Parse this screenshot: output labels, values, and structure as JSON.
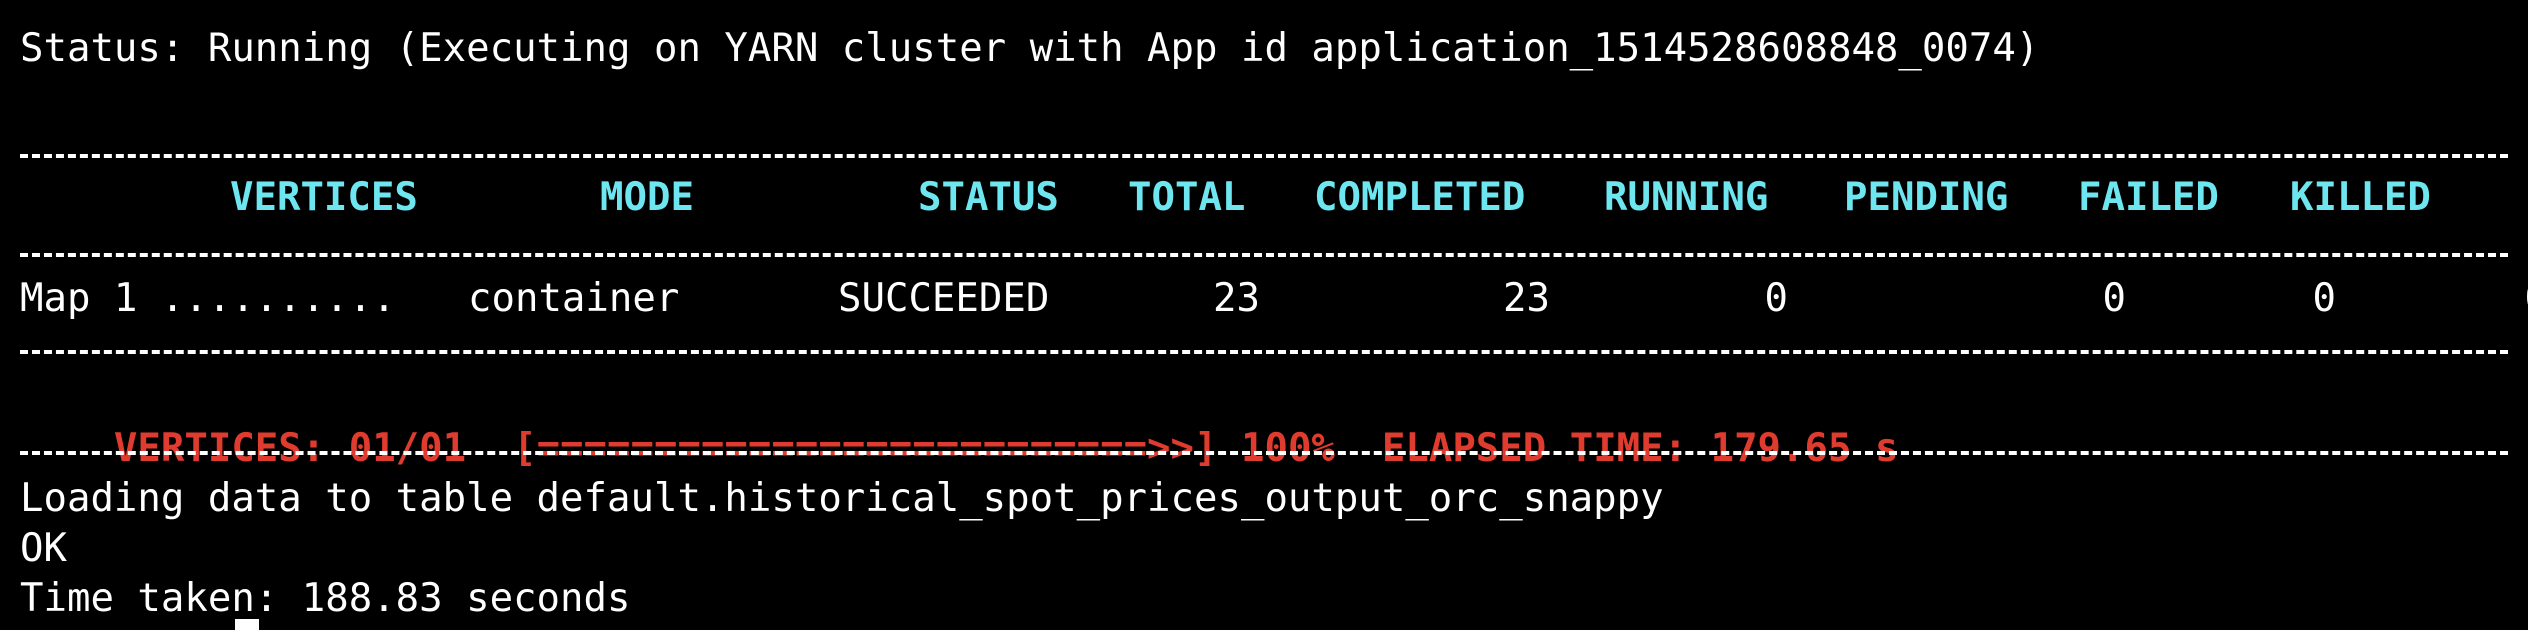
{
  "terminal": {
    "status_line": "Status: Running (Executing on YARN cluster with App id application_1514528608848_0074)",
    "columns": [
      "VERTICES",
      "MODE",
      "STATUS",
      "TOTAL",
      "COMPLETED",
      "RUNNING",
      "PENDING",
      "FAILED",
      "KILLED"
    ],
    "rows": [
      {
        "vertex": "Map 1 ..........",
        "mode": "container",
        "status": "SUCCEEDED",
        "total": "23",
        "completed": "23",
        "running": "0",
        "pending": "0",
        "failed": "0",
        "killed": "0"
      }
    ],
    "progress": {
      "vertices_label": "VERTICES: 01/01",
      "bar_text": "[==========================>>]",
      "percent": "100%",
      "elapsed": "ELAPSED TIME: 179.65 s",
      "fraction_complete": 1.0
    },
    "output_lines": [
      "Loading data to table default.historical_spot_prices_output_orc_snappy",
      "OK",
      "Time taken: 188.83 seconds"
    ],
    "colors": {
      "background": "#000000",
      "text": "#ffffff",
      "header": "#6ee6f0",
      "progress": "#e03b2f"
    }
  }
}
